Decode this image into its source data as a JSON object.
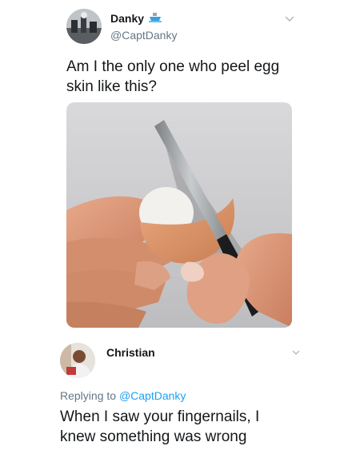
{
  "tweet": {
    "author_name": "Danky",
    "author_handle": "@CaptDanky",
    "text": "Am I the only one who peel egg skin like this?",
    "badge_icon": "ship-emoji",
    "menu_icon": "chevron-down-icon"
  },
  "reply": {
    "author_name": "Christian",
    "replying_prefix": "Replying to ",
    "replying_handle": "@CaptDanky",
    "text": "When I saw your fingernails, I knew something was wrong",
    "menu_icon": "chevron-down-icon"
  },
  "colors": {
    "text": "#14171a",
    "secondary": "#657786",
    "link": "#1da1f2"
  }
}
